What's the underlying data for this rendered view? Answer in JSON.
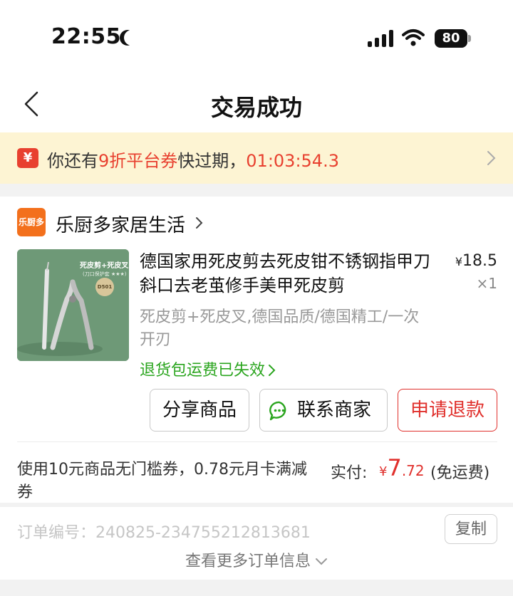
{
  "status_bar": {
    "time": "22:55",
    "battery": "80"
  },
  "nav": {
    "title": "交易成功"
  },
  "coupon_banner": {
    "icon_glyph": "¥",
    "text_before": "你还有",
    "highlight": "9折平台券",
    "text_after": "快过期，",
    "countdown": "01:03:54.3"
  },
  "shop": {
    "logo_text": "乐厨多",
    "name": "乐厨多家居生活"
  },
  "product": {
    "image_label": "死皮剪+死皮叉",
    "image_sub": "(刀口保护套 ★★★)",
    "image_badge": "D501",
    "title": "德国家用死皮剪去死皮钳不锈钢指甲刀斜口去老茧修手美甲死皮剪",
    "price_symbol": "¥",
    "price": "18.5",
    "quantity": "×1",
    "specs": "死皮剪+死皮叉,德国品质/德国精工/一次开刃",
    "return_notice": "退货包运费已失效"
  },
  "actions": {
    "share": "分享商品",
    "contact": "联系商家",
    "refund": "申请退款"
  },
  "payment": {
    "coupons_used": "使用10元商品无门槛券，0.78元月卡满减券",
    "paid_label": "实付:",
    "paid_symbol": "¥",
    "paid_int": "7",
    "paid_frac": ".72",
    "shipping": "(免运费)"
  },
  "order": {
    "number": "订单编号：240825-234755212813681",
    "copy_label": "复制",
    "more_label": "查看更多订单信息"
  },
  "colors": {
    "accent_red": "#e0302c",
    "green": "#2aa51e",
    "banner_bg": "#fdf4d3",
    "shop_orange": "#f3701c"
  },
  "icons": [
    "back-arrow",
    "chevron-right",
    "chat-bubble",
    "chevron-down",
    "signal",
    "wifi",
    "battery",
    "moon"
  ]
}
